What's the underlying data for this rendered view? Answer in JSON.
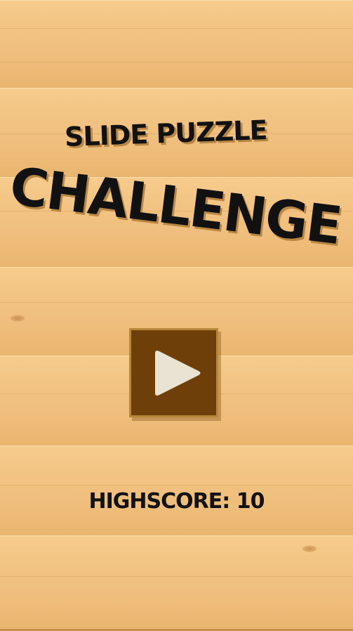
{
  "title": {
    "line1": "SLIDE PUZZLE",
    "line2": "CHALLENGE"
  },
  "play_button": {
    "icon": "play-icon",
    "color": "#6f3f09",
    "border_color": "#b7873a"
  },
  "highscore": {
    "label": "HIGHSCORE: 10"
  },
  "background": {
    "wood_color": "#f0be79"
  }
}
